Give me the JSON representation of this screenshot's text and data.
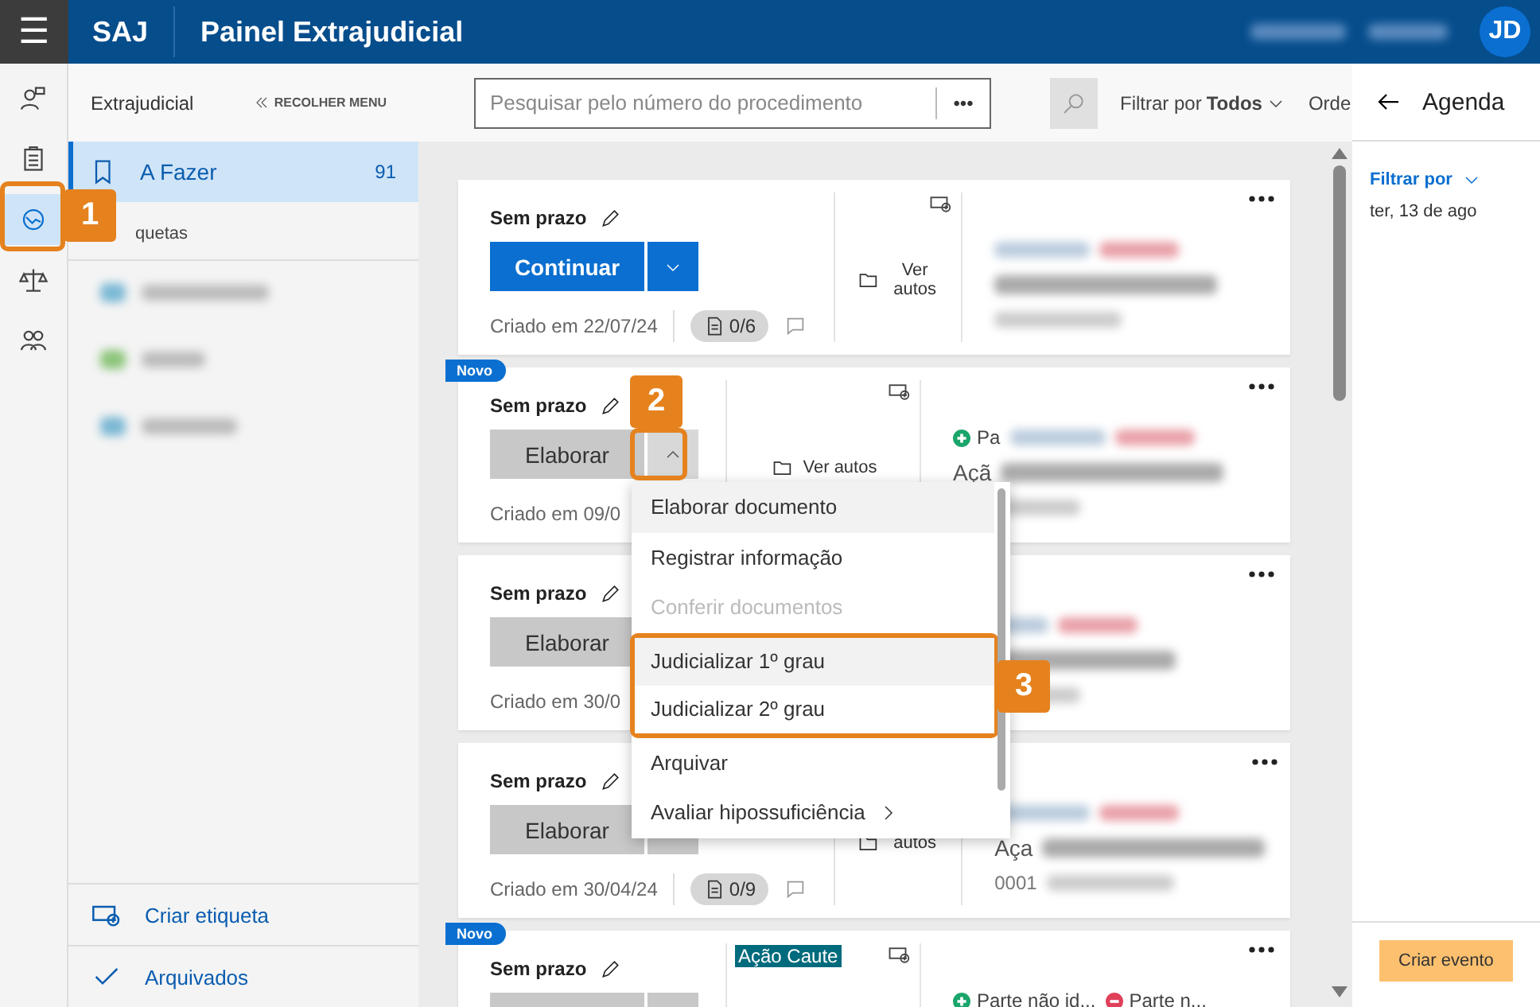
{
  "header": {
    "menu_icon": "☰",
    "brand": "SAJ",
    "title": "Painel Extrajudicial",
    "avatar": "JD"
  },
  "rail": [
    {
      "selected": false
    },
    {
      "selected": false
    },
    {
      "selected": true
    },
    {
      "selected": false
    },
    {
      "selected": false
    }
  ],
  "sidebar": {
    "title": "Extrajudicial",
    "collapse": "RECOLHER MENU",
    "items": [
      {
        "label": "A Fazer",
        "count": "91",
        "selected": true
      }
    ],
    "section_label": "quetas",
    "footer": [
      {
        "label": "Criar etiqueta"
      },
      {
        "label": "Arquivados"
      }
    ]
  },
  "toolbar": {
    "search": {
      "placeholder": "Pesquisar pelo número do procedimento",
      "more": "•••"
    },
    "filter_label": "Filtrar por",
    "filter_value": "Todos",
    "order_label": "Orde"
  },
  "cards": [
    {
      "is_new": false,
      "deadline": "Sem prazo",
      "action": {
        "label": "Continuar",
        "kind": "primary"
      },
      "menu_open": false,
      "created": "Criado em 22/07/24",
      "docs": "0/6",
      "autos": "Ver autos",
      "autos_wrap": true
    },
    {
      "is_new": true,
      "new_label": "Novo",
      "deadline": "Sem prazo",
      "action": {
        "label": "Elaborar",
        "kind": "secondary"
      },
      "menu_open": true,
      "created": "Criado em 09/0",
      "autos": "Ver autos",
      "autos_wrap": false,
      "right": {
        "parties": [
          {
            "kind": "plus",
            "text": "Pa"
          }
        ],
        "title": "Açã"
      }
    },
    {
      "is_new": false,
      "deadline": "Sem prazo",
      "action": {
        "label": "Elaborar",
        "kind": "secondary"
      },
      "created": "Criado em 30/0"
    },
    {
      "is_new": false,
      "deadline": "Sem prazo",
      "action": {
        "label": "Elaborar",
        "kind": "secondary"
      },
      "created": "Criado em 30/04/24",
      "docs": "0/9",
      "autos": "autos",
      "autos_wrap": true,
      "right": {
        "title": "Aça",
        "number": "0001"
      }
    },
    {
      "is_new": true,
      "new_label": "Novo",
      "deadline": "Sem prazo",
      "action": {
        "kind": "secondary"
      },
      "tag": "Ação Caute",
      "right": {
        "parties": [
          {
            "kind": "plus",
            "text": "Parte não id..."
          },
          {
            "kind": "minus",
            "text": "Parte n..."
          }
        ]
      }
    }
  ],
  "menu": [
    {
      "label": "Elaborar documento",
      "disabled": false,
      "hovered": true,
      "submenu": false
    },
    {
      "label": "Registrar informação",
      "disabled": false,
      "hovered": false,
      "submenu": false
    },
    {
      "label": "Conferir documentos",
      "disabled": true,
      "hovered": false,
      "submenu": false
    },
    {
      "label": "Judicializar 1º grau",
      "disabled": false,
      "hovered": true,
      "submenu": false
    },
    {
      "label": "Judicializar 2º grau",
      "disabled": false,
      "hovered": false,
      "submenu": false
    },
    {
      "label": "Arquivar",
      "disabled": false,
      "hovered": false,
      "submenu": false
    },
    {
      "label": "Avaliar hipossuficiência",
      "disabled": false,
      "hovered": false,
      "submenu": true
    }
  ],
  "agenda": {
    "title": "Agenda",
    "filter": "Filtrar por",
    "date": "ter, 13 de ago",
    "create": "Criar evento"
  },
  "callouts": [
    {
      "number": "1"
    },
    {
      "number": "2"
    },
    {
      "number": "3"
    }
  ]
}
